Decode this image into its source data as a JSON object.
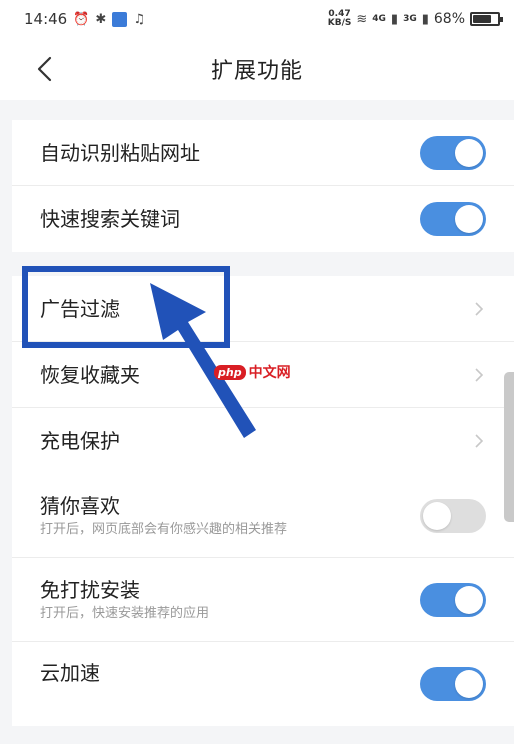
{
  "status_bar": {
    "time": "14:46",
    "net_speed_value": "0.47",
    "net_speed_unit": "KB/S",
    "signal_1": "4G",
    "signal_2": "3G",
    "battery_text": "68%",
    "battery_level": 0.68,
    "icons": [
      "alarm-icon",
      "bluetooth-icon",
      "shield-icon",
      "qq-icon",
      "wifi-icon",
      "signal-icon",
      "battery-icon"
    ]
  },
  "header": {
    "title": "扩展功能"
  },
  "sections": {
    "toggles_top": [
      {
        "label": "自动识别粘贴网址",
        "enabled": true
      },
      {
        "label": "快速搜索关键词",
        "enabled": true
      }
    ],
    "links": [
      {
        "label": "广告过滤"
      },
      {
        "label": "恢复收藏夹"
      },
      {
        "label": "充电保护"
      }
    ],
    "toggles_bottom": [
      {
        "label": "猜你喜欢",
        "sublabel": "打开后，网页底部会有你感兴趣的相关推荐",
        "enabled": false
      },
      {
        "label": "免打扰安装",
        "sublabel": "打开后，快速安装推荐的应用",
        "enabled": true
      },
      {
        "label": "云加速",
        "sublabel": "",
        "enabled": true
      }
    ]
  },
  "watermark": {
    "badge": "php",
    "text": "中文网"
  },
  "colors": {
    "toggle_on": "#4a8fe0",
    "toggle_off": "#dedede",
    "annotation_blue": "#2152b8",
    "watermark_red": "#d91e24"
  }
}
